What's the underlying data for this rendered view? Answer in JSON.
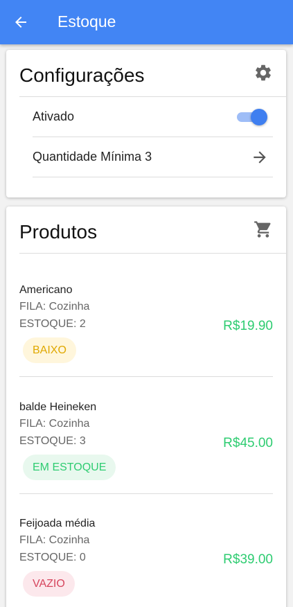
{
  "appbar": {
    "title": "Estoque",
    "back_icon": "arrow-left-icon"
  },
  "settings": {
    "title": "Configurações",
    "icon": "gear-icon",
    "activated_label": "Ativado",
    "activated_value": true,
    "min_qty_label": "Quantidade Mínima 3"
  },
  "products": {
    "title": "Produtos",
    "icon": "cart-icon",
    "items": [
      {
        "name": "Americano",
        "queue": "FILA: Cozinha",
        "stock": "ESTOQUE: 2",
        "price": "R$19.90",
        "status": "BAIXO",
        "status_color": "#e0a800"
      },
      {
        "name": "balde Heineken",
        "queue": "FILA: Cozinha",
        "stock": "ESTOQUE: 3",
        "price": "R$45.00",
        "status": "EM ESTOQUE",
        "status_color": "#2ecc71"
      },
      {
        "name": "Feijoada média",
        "queue": "FILA: Cozinha",
        "stock": "ESTOQUE: 0",
        "price": "R$39.00",
        "status": "VAZIO",
        "status_color": "#d6455d"
      }
    ]
  },
  "colors": {
    "primary": "#4285f4",
    "price": "#2ecc71"
  }
}
